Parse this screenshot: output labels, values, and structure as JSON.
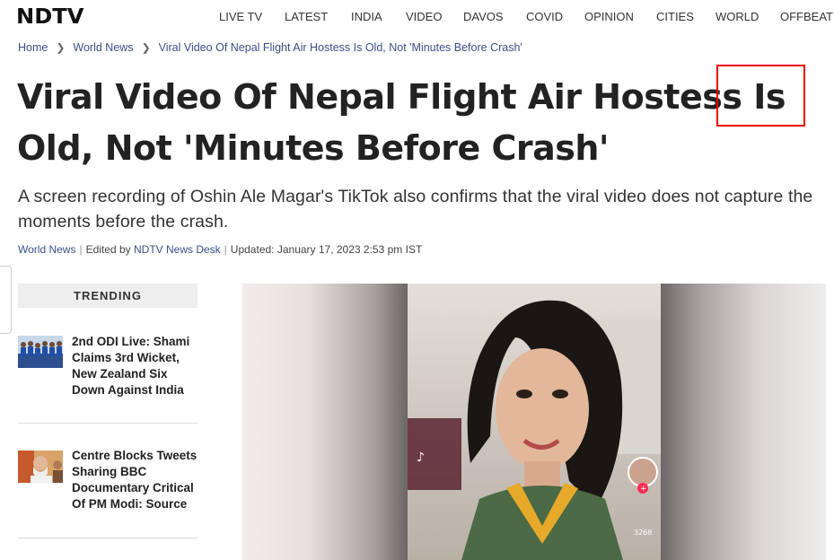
{
  "site": {
    "logo": "NDTV"
  },
  "nav": {
    "items": [
      "LIVE TV",
      "LATEST",
      "INDIA",
      "VIDEO",
      "DAVOS",
      "COVID",
      "OPINION",
      "CITIES",
      "WORLD",
      "OFFBEAT"
    ]
  },
  "breadcrumb": {
    "home": "Home",
    "section": "World News",
    "current": "Viral Video Of Nepal Flight Air Hostess Is Old, Not 'Minutes Before Crash'"
  },
  "article": {
    "headline": "Viral Video Of Nepal Flight Air Hostess Is Old, Not 'Minutes Before Crash'",
    "subhead": "A screen recording of Oshin Ale Magar's TikTok also confirms that the viral video does not capture the moments before the crash.",
    "meta": {
      "category": "World News",
      "edited_prefix": "Edited by",
      "editor": "NDTV News Desk",
      "updated_label": "Updated:",
      "updated": "January 17, 2023 2:53 pm IST"
    }
  },
  "sidebar": {
    "trending_label": "TRENDING",
    "items": [
      {
        "title": "2nd ODI Live: Shami Claims 3rd Wicket, New Zealand Six Down Against India"
      },
      {
        "title": "Centre Blocks Tweets Sharing BBC Documentary Critical Of PM Modi: Source"
      }
    ]
  },
  "video": {
    "overlay_count": "3268"
  },
  "colors": {
    "accent_red": "#e00000",
    "link_blue": "#3a4f8a",
    "highlight_box": "#e00000"
  }
}
